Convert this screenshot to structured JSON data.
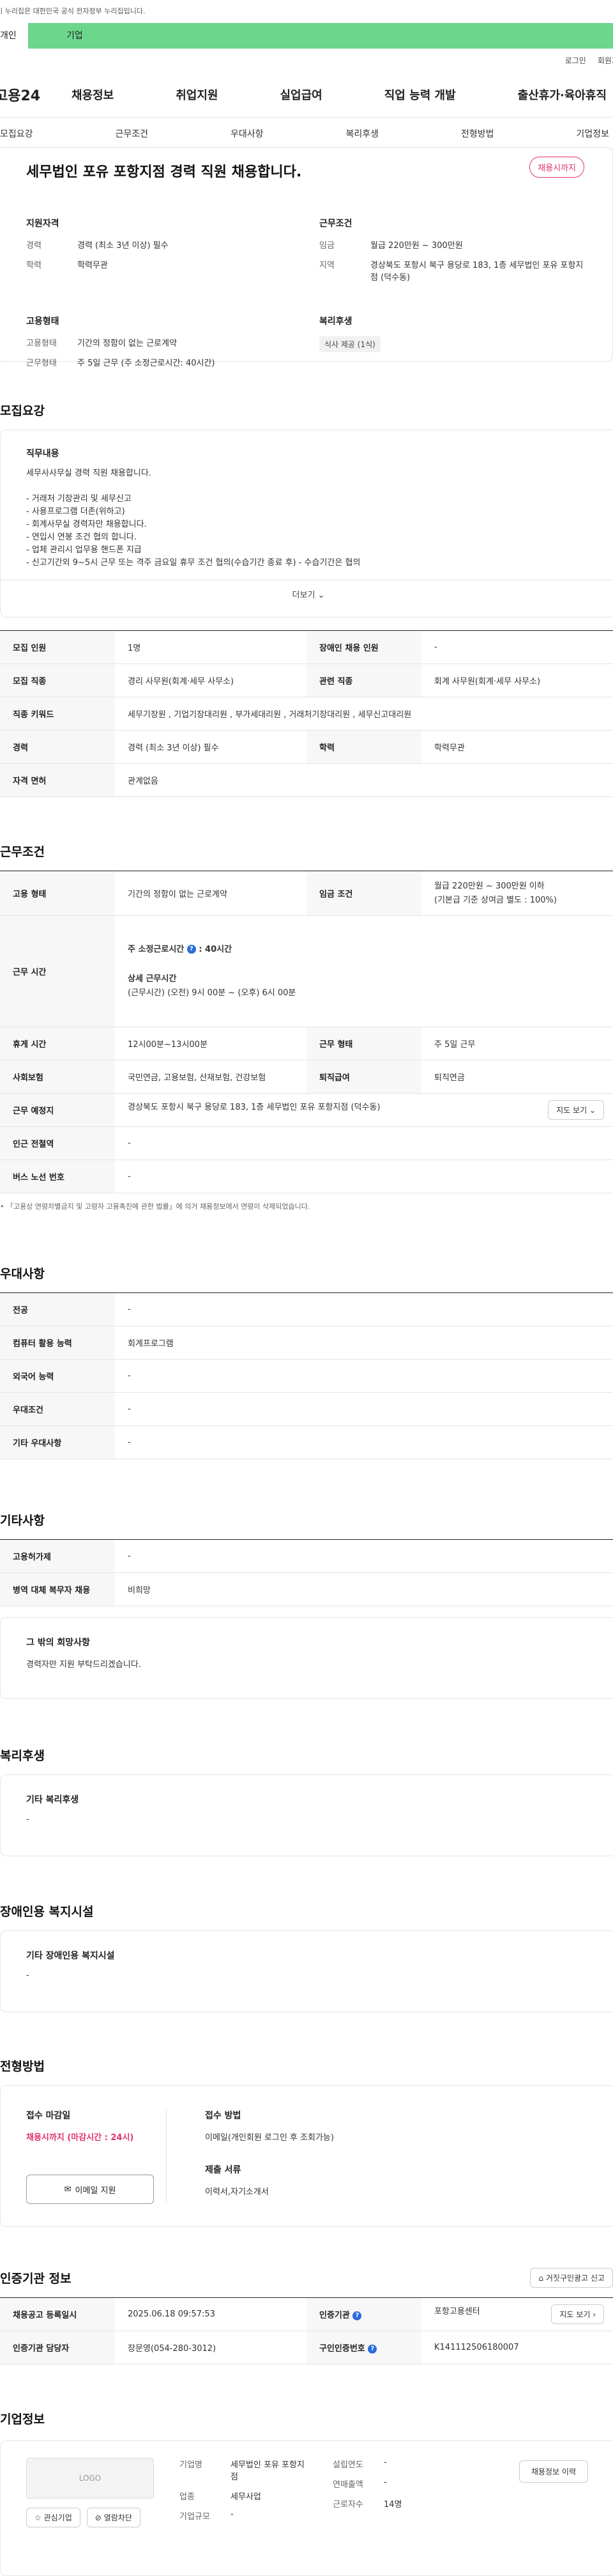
{
  "gov_banner": "이 누리집은 대한민국 공식 전자정부 누리집입니다.",
  "top_tabs": {
    "personal": "개인",
    "company": "기업"
  },
  "util": {
    "login": "로그인",
    "signup": "회원가입"
  },
  "gnb": {
    "logo": "고용24",
    "items": [
      "채용정보",
      "취업지원",
      "실업급여",
      "직업 능력 개발",
      "출산휴가·육아휴직"
    ]
  },
  "subnav": [
    "모집요강",
    "근무조건",
    "우대사항",
    "복리후생",
    "전형방법",
    "기업정보"
  ],
  "header": {
    "title": "세무법인 포유 포항지점 경력 직원 채용합니다.",
    "badge": "채용시까지",
    "qualification": {
      "title": "지원자격",
      "career_k": "경력",
      "career_v": "경력 (최소 3년 이상) 필수",
      "edu_k": "학력",
      "edu_v": "학력무관"
    },
    "conditions": {
      "title": "근무조건",
      "wage_k": "임금",
      "wage_v": "월급 220만원 ~ 300만원",
      "area_k": "지역",
      "area_v": "경상북도 포항시 북구 용당로 183, 1층 세무법인 포유 포항지점 (덕수동)"
    },
    "employment": {
      "title": "고용형태",
      "type_k": "고용형태",
      "type_v": "기간의 정함이 없는 근로계약",
      "time_k": "근무형태",
      "time_v": "주 5일 근무 (주 소정근로시간: 40시간)"
    },
    "welfare": {
      "title": "복리후생",
      "chip": "식사 제공 (1식)"
    }
  },
  "recruit": {
    "title": "모집요강",
    "duty_title": "직무내용",
    "duty_text": "세무사사무실 경력 직원 채용합니다.\n\n- 거래처 기장관리 및 세무신고\n- 사용프로그램 더존(위하고)\n- 회계사무실 경력자만 채용합니다.\n- 연입시 연봉 조건 협의 합니다.\n- 업체 관리시 업무용 핸드폰 지급\n- 신고기간외 9~5시 근무 또는 격주 금요일 휴무 조건 협의(수습기간 종료 후) - 수습기간은 협의",
    "more": "더보기",
    "rows": [
      {
        "k1": "모집 인원",
        "v1": "1명",
        "k2": "장애인 채용 인원",
        "v2": "-"
      },
      {
        "k1": "모집 직종",
        "v1": "경리 사무원(회계·세무 사무소)",
        "k2": "관련 직종",
        "v2": "회계 사무원(회계·세무 사무소)"
      },
      {
        "k1": "직종 키워드",
        "v1": "세무기장원 , 기업기장대리원 , 부가세대리원 , 거래처기장대리원 , 세무신고대리원"
      },
      {
        "k1": "경력",
        "v1": "경력 (최소 3년 이상) 필수",
        "k2": "학력",
        "v2": "학력무관"
      },
      {
        "k1": "자격 면허",
        "v1": "관계없음"
      }
    ]
  },
  "work": {
    "title": "근무조건",
    "type_k": "고용 형태",
    "type_v": "기간의 정함이 없는 근로계약",
    "wage_k": "임금 조건",
    "wage_v1": "월급 220만원 ~ 300만원 이하",
    "wage_v2": "(기본급 기준 상여금 별도 : 100%)",
    "hours_k": "근무 시간",
    "hours_t1": "주 소정근로시간",
    "hours_v1": "40시간",
    "hours_t2": "상세 근무시간",
    "hours_v2": "(근무시간) (오전) 9시 00분 ~ (오후) 6시 00분",
    "rest_k": "휴게 시간",
    "rest_v": "12시00분~13시00분",
    "shift_k": "근무 형태",
    "shift_v": "주 5일 근무",
    "ins_k": "사회보험",
    "ins_v": "국민연금, 고용보험, 산재보험, 건강보험",
    "sev_k": "퇴직급여",
    "sev_v": "퇴직연금",
    "place_k": "근무 예정지",
    "place_v": "경상북도 포항시 북구 용당로 183, 1층 세무법인 포유 포항지점 (덕수동)",
    "map_btn": "지도 보기",
    "subway_k": "인근 전철역",
    "subway_v": "-",
    "bus_k": "버스 노선 번호",
    "bus_v": "-",
    "note": "「고용상 연령차별금지 및 고령자 고용촉진에 관한 법률」에 의거 채용정보에서 연령이 삭제되었습니다."
  },
  "pref": {
    "title": "우대사항",
    "rows": [
      [
        "전공",
        "-"
      ],
      [
        "컴퓨터 활용 능력",
        "회계프로그램"
      ],
      [
        "외국어 능력",
        "-"
      ],
      [
        "우대조건",
        "-"
      ],
      [
        "기타 우대사항",
        "-"
      ]
    ]
  },
  "etc": {
    "title": "기타사항",
    "rows": [
      [
        "고용허가제",
        "-"
      ],
      [
        "병역 대체 복무자 채용",
        "비희망"
      ]
    ],
    "other_title": "그 밖의 희망사항",
    "other_text": "경력자만 지원 부탁드리겠습니다."
  },
  "welfare": {
    "title": "복리후생",
    "sub": "기타 복리후생",
    "val": "-"
  },
  "disabled": {
    "title": "장애인용 복지시설",
    "sub": "기타 장애인용 복지시설",
    "val": "-"
  },
  "process": {
    "title": "전형방법",
    "deadline_t": "접수 마감일",
    "deadline_v": "채용시까지 (마감시간 : 24시)",
    "email_btn": "이메일 지원",
    "method_t": "접수 방법",
    "method_v": "이메일(개인회원 로그인 후 조회가능)",
    "docs_t": "제출 서류",
    "docs_v": "이력서,자기소개서"
  },
  "agency": {
    "title": "인증기관 정보",
    "report_btn": "거짓구인광고 신고",
    "r1": {
      "k1": "채용공고 등록일시",
      "v1": "2025.06.18 09:57:53",
      "k2": "인증기관",
      "v2": "포항고용센터",
      "btn": "지도 보기"
    },
    "r2": {
      "k1": "인증기관 담당자",
      "v1": "장문영(054-280-3012)",
      "k2": "구인인증번호",
      "v2": "K141112506180007"
    }
  },
  "company": {
    "title": "기업정보",
    "logo": "LOGO",
    "fav_btn": "관심기업",
    "block_btn": "열람차단",
    "name_k": "기업명",
    "name_v": "세무법인 포유 포항지점",
    "ind_k": "업종",
    "ind_v": "세무사업",
    "size_k": "기업규모",
    "size_v": "-",
    "year_k": "설립연도",
    "year_v": "-",
    "sales_k": "연매출액",
    "sales_v": "-",
    "emp_k": "근로자수",
    "emp_v": "14명",
    "more_btn": "채용정보 이력"
  }
}
